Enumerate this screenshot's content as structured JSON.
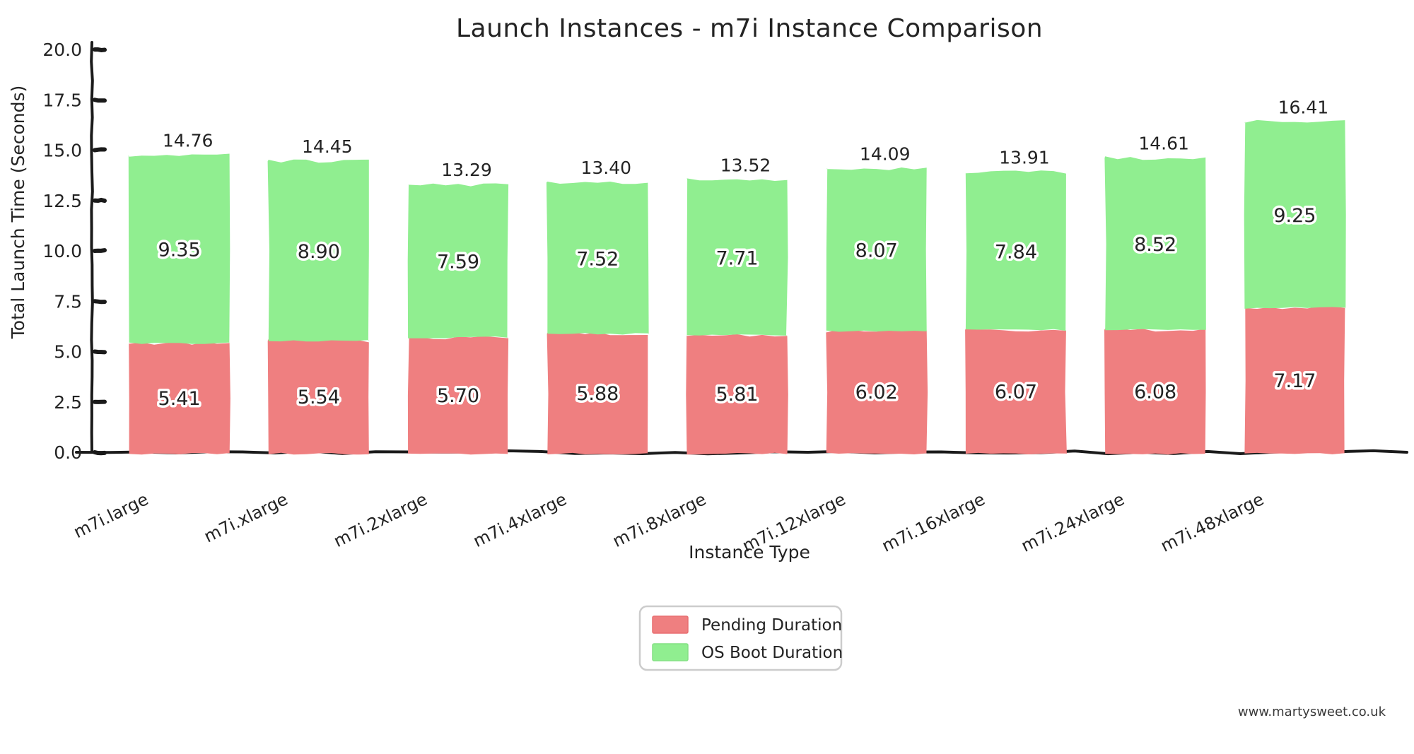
{
  "chart_data": {
    "type": "bar",
    "subtype": "stacked-bar",
    "title": "Launch Instances - m7i Instance Comparison",
    "xlabel": "Instance Type",
    "ylabel": "Total Launch Time (Seconds)",
    "ylim": [
      0.0,
      20.0
    ],
    "ytick_labels": [
      "0.0",
      "2.5",
      "5.0",
      "7.5",
      "10.0",
      "12.5",
      "15.0",
      "17.5",
      "20.0"
    ],
    "ytick_values": [
      0.0,
      2.5,
      5.0,
      7.5,
      10.0,
      12.5,
      15.0,
      17.5,
      20.0
    ],
    "grid": false,
    "legend_position": "bottom-center",
    "categories": [
      "m7i.large",
      "m7i.xlarge",
      "m7i.2xlarge",
      "m7i.4xlarge",
      "m7i.8xlarge",
      "m7i.12xlarge",
      "m7i.16xlarge",
      "m7i.24xlarge",
      "m7i.48xlarge"
    ],
    "series": [
      {
        "name": "Pending Duration",
        "color": "#ef7f80",
        "values": [
          5.41,
          5.54,
          5.7,
          5.88,
          5.81,
          6.02,
          6.07,
          6.08,
          7.17
        ],
        "labels": [
          "5.41",
          "5.54",
          "5.70",
          "5.88",
          "5.81",
          "6.02",
          "6.07",
          "6.08",
          "7.17"
        ]
      },
      {
        "name": "OS Boot Duration",
        "color": "#90ee90",
        "values": [
          9.35,
          8.9,
          7.59,
          7.52,
          7.71,
          8.07,
          7.84,
          8.52,
          9.25
        ],
        "labels": [
          "9.35",
          "8.90",
          "7.59",
          "7.52",
          "7.71",
          "8.07",
          "7.84",
          "8.52",
          "9.25"
        ]
      }
    ],
    "totals": [
      14.76,
      14.45,
      13.29,
      13.4,
      13.52,
      14.09,
      13.91,
      14.61,
      16.41
    ],
    "total_labels": [
      "14.76",
      "14.45",
      "13.29",
      "13.40",
      "13.52",
      "14.09",
      "13.91",
      "14.61",
      "16.41"
    ]
  },
  "legend": {
    "entries": [
      {
        "label": "Pending Duration",
        "color": "#ef7f80"
      },
      {
        "label": "OS Boot Duration",
        "color": "#90ee90"
      }
    ]
  },
  "watermark": {
    "text": "www.martysweet.co.uk"
  },
  "colors": {
    "pending": "#ef7f80",
    "os_boot": "#90ee90",
    "axis": "#1a1a1a",
    "text": "#232323",
    "background": "#ffffff"
  }
}
